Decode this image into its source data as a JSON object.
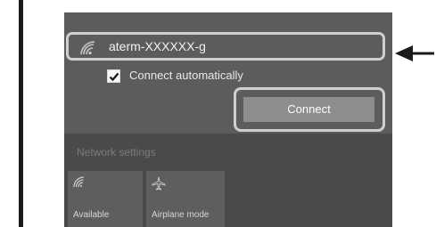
{
  "network": {
    "name": "aterm-XXXXXX-g",
    "icon": "wifi-signal-icon"
  },
  "options": {
    "connect_automatically_label": "Connect automatically",
    "connect_automatically_checked": true
  },
  "actions": {
    "connect_label": "Connect"
  },
  "settings": {
    "label": "Network settings"
  },
  "quick_actions": [
    {
      "label": "Available",
      "icon": "wifi-icon"
    },
    {
      "label": "Airplane mode",
      "icon": "airplane-icon"
    }
  ],
  "colors": {
    "panel": "#4a4a4a",
    "panel_top": "#5c5c5c",
    "button": "#8e8e8e",
    "highlight": "#cfcfcf"
  }
}
